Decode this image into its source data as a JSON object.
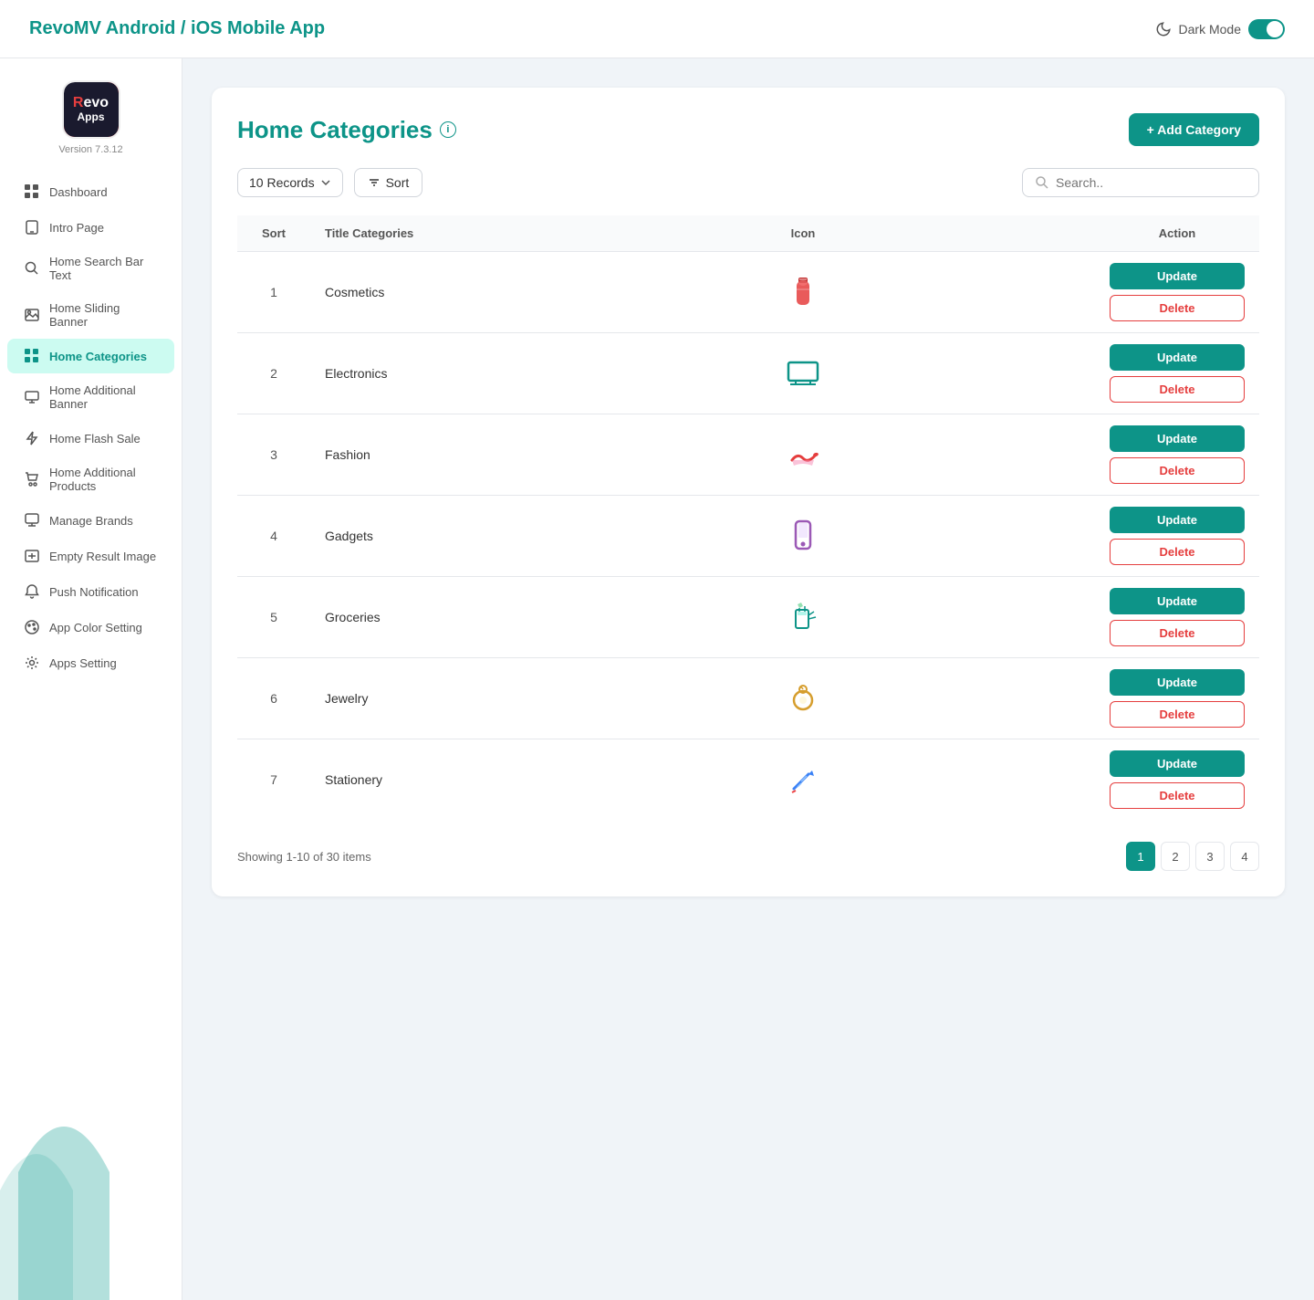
{
  "app": {
    "title": "RevoMV Android / iOS Mobile App",
    "version": "Version 7.3.12",
    "dark_mode_label": "Dark Mode"
  },
  "sidebar": {
    "items": [
      {
        "id": "dashboard",
        "label": "Dashboard",
        "icon": "grid-icon"
      },
      {
        "id": "intro-page",
        "label": "Intro Page",
        "icon": "phone-icon"
      },
      {
        "id": "home-search-bar-text",
        "label": "Home Search Bar Text",
        "icon": "search-icon"
      },
      {
        "id": "home-sliding-banner",
        "label": "Home Sliding Banner",
        "icon": "image-icon"
      },
      {
        "id": "home-categories",
        "label": "Home Categories",
        "icon": "apps-icon",
        "active": true
      },
      {
        "id": "home-additional-banner",
        "label": "Home Additional Banner",
        "icon": "monitor-icon"
      },
      {
        "id": "home-flash-sale",
        "label": "Home Flash Sale",
        "icon": "flash-icon"
      },
      {
        "id": "home-additional-products",
        "label": "Home Additional Products",
        "icon": "cart-icon"
      },
      {
        "id": "manage-brands",
        "label": "Manage Brands",
        "icon": "tag-icon"
      },
      {
        "id": "empty-result-image",
        "label": "Empty Result Image",
        "icon": "image2-icon"
      },
      {
        "id": "push-notification",
        "label": "Push Notification",
        "icon": "bell-icon"
      },
      {
        "id": "app-color-setting",
        "label": "App Color Setting",
        "icon": "palette-icon"
      },
      {
        "id": "apps-setting",
        "label": "Apps Setting",
        "icon": "gear-icon"
      }
    ]
  },
  "page": {
    "title": "Home Categories",
    "add_button_label": "+ Add Category",
    "records_label": "10 Records",
    "sort_label": "Sort",
    "search_placeholder": "Search..",
    "showing_text": "Showing 1-10 of 30 items"
  },
  "table": {
    "headers": [
      "Sort",
      "Title Categories",
      "Icon",
      "Action"
    ],
    "rows": [
      {
        "num": 1,
        "title": "Cosmetics",
        "icon": "cosmetics"
      },
      {
        "num": 2,
        "title": "Electronics",
        "icon": "electronics"
      },
      {
        "num": 3,
        "title": "Fashion",
        "icon": "fashion"
      },
      {
        "num": 4,
        "title": "Gadgets",
        "icon": "gadgets"
      },
      {
        "num": 5,
        "title": "Groceries",
        "icon": "groceries"
      },
      {
        "num": 6,
        "title": "Jewelry",
        "icon": "jewelry"
      },
      {
        "num": 7,
        "title": "Stationery",
        "icon": "stationery"
      }
    ],
    "update_label": "Update",
    "delete_label": "Delete"
  },
  "pagination": {
    "pages": [
      1,
      2,
      3,
      4
    ],
    "active_page": 1
  }
}
